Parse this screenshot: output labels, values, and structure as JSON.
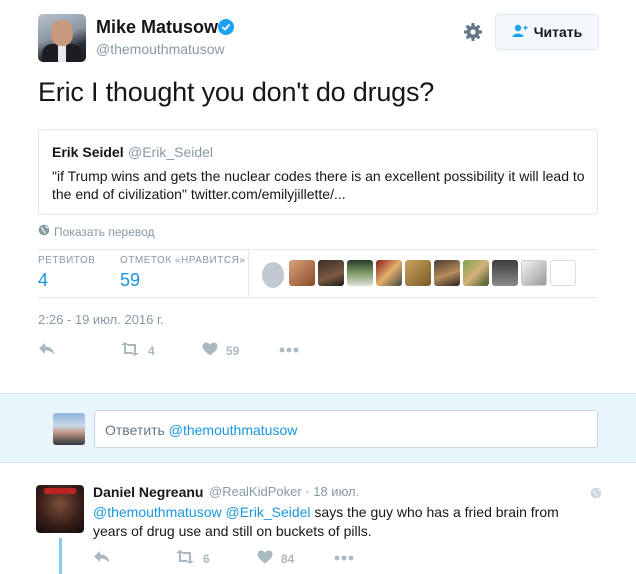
{
  "tweet": {
    "author_name": "Mike Matusow",
    "author_handle": "@themouthmatusow",
    "follow_label": "Читать",
    "text": "Eric I thought you don't do drugs?",
    "quote": {
      "name": "Erik Seidel",
      "handle": "@Erik_Seidel",
      "text": "\"if Trump wins and gets the nuclear codes there is an excellent possibility it will lead to the end of civilization\" twitter.com/emilyjillette/..."
    },
    "translate_label": "Показать перевод",
    "stats": {
      "retweets_label": "РЕТВИТОВ",
      "retweets_value": "4",
      "likes_label": "ОТМЕТОК «НРАВИТСЯ»",
      "likes_value": "59"
    },
    "timestamp": "2:26 - 19 июл. 2016 г.",
    "actions": {
      "retweet_count": "4",
      "like_count": "59"
    }
  },
  "reply_box": {
    "prefix": "Ответить",
    "mention": "@themouthmatusow"
  },
  "reply": {
    "name": "Daniel Negreanu",
    "handle_date": "@RealKidPoker · 18 июл.",
    "mention1": "@themouthmatusow",
    "mention2": "@Erik_Seidel",
    "text": " says the guy who has a fried brain from years of drug use and still on buckets of pills.",
    "retweet_count": "6",
    "like_count": "84"
  },
  "colors": {
    "accent": "#1b95e0",
    "verified": "#1da1f2",
    "reply_bar_bg": "#e8f5fd",
    "muted": "#8899a6",
    "thread_line": "#8ec9f0"
  },
  "icons": [
    "verified-icon",
    "gear-icon",
    "follow-user-icon",
    "globe-icon",
    "reply-icon",
    "retweet-icon",
    "heart-icon",
    "more-icon"
  ]
}
